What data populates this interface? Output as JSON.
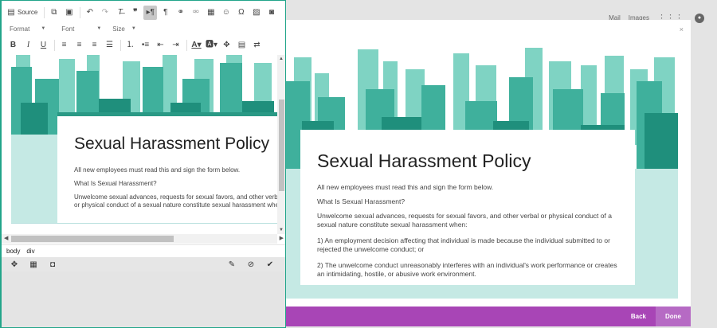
{
  "editor": {
    "toolbar": {
      "source_label": "Source",
      "format_label": "Format",
      "font_label": "Font",
      "size_label": "Size"
    },
    "path": [
      "body",
      "div"
    ]
  },
  "document": {
    "title": "Sexual Harassment Policy",
    "paragraphs": [
      "All new employees must read this and sign the form below.",
      "What Is Sexual Harassment?",
      "Unwelcome sexual advances, requests for sexual favors, and other verbal or physical conduct of a sexual nature constitute sexual harassment when:",
      "1) An employment decision affecting that individual is made because the individual submitted to or rejected the unwelcome conduct; or",
      "2) The unwelcome conduct unreasonably interferes with an individual's work performance or creates an intimidating, hostile, or abusive work environment."
    ]
  },
  "editor_preview": {
    "p3": "Unwelcome sexual advances, requests for sexual favors, and other verbal or physical conduct of a sexual nature constitute sexual harassment when:"
  },
  "topnav": {
    "mail": "Mail",
    "images": "Images"
  },
  "modal": {
    "back_label": "Back",
    "done_label": "Done",
    "close_glyph": "×"
  },
  "colors": {
    "accent": "#a845b6",
    "teal": "#22a58a",
    "skyline": "#5ec3b0"
  }
}
